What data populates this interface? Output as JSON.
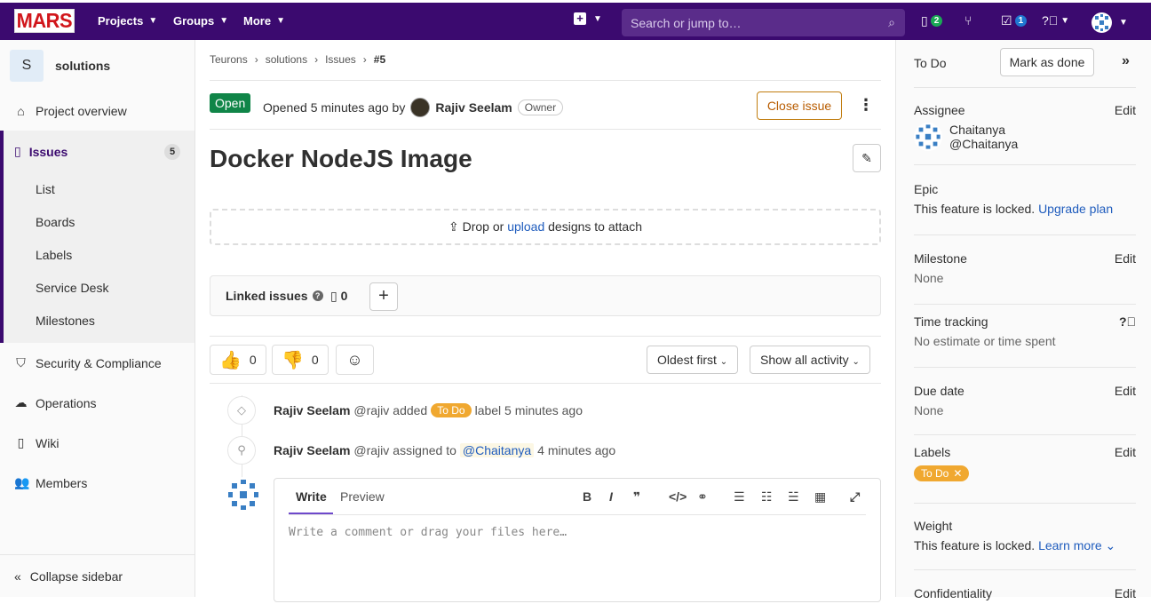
{
  "nav": {
    "logo": "MARS",
    "projects": "Projects",
    "groups": "Groups",
    "more": "More",
    "search_placeholder": "Search or jump to…",
    "mr_count": "2",
    "todo_count": "1"
  },
  "sidebar": {
    "project_initial": "S",
    "project_name": "solutions",
    "project_overview": "Project overview",
    "issues": "Issues",
    "issues_count": "5",
    "sub": [
      "List",
      "Boards",
      "Labels",
      "Service Desk",
      "Milestones"
    ],
    "security": "Security & Compliance",
    "operations": "Operations",
    "wiki": "Wiki",
    "members": "Members",
    "collapse": "Collapse sidebar"
  },
  "breadcrumb": [
    "Teurons",
    "solutions",
    "Issues",
    "#5"
  ],
  "issue": {
    "status": "Open",
    "opened_text": "Opened 5 minutes ago by",
    "author": "Rajiv Seelam",
    "author_role": "Owner",
    "close_label": "Close issue",
    "title": "Docker NodeJS Image",
    "drop_prefix": "Drop or",
    "drop_link": "upload",
    "drop_suffix": "designs to attach",
    "linked_label": "Linked issues",
    "linked_count": "0",
    "thumbs_up": "0",
    "thumbs_down": "0",
    "sort": "Oldest first",
    "filter": "Show all activity"
  },
  "notes": [
    {
      "author": "Rajiv Seelam",
      "handle": "@rajiv",
      "action": "added",
      "label": "To Do",
      "suffix": "label 5 minutes ago"
    },
    {
      "author": "Rajiv Seelam",
      "handle": "@rajiv",
      "action": "assigned to",
      "mention": "@Chaitanya",
      "suffix": "4 minutes ago"
    }
  ],
  "editor": {
    "write": "Write",
    "preview": "Preview",
    "placeholder": "Write a comment or drag your files here…"
  },
  "rightbar": {
    "todo": "To Do",
    "mark_done": "Mark as done",
    "edit": "Edit",
    "assignee_title": "Assignee",
    "assignee_name": "Chaitanya",
    "assignee_handle": "@Chaitanya",
    "epic_title": "Epic",
    "epic_locked": "This feature is locked.",
    "epic_link": "Upgrade plan",
    "milestone_title": "Milestone",
    "milestone_val": "None",
    "time_title": "Time tracking",
    "time_val": "No estimate or time spent",
    "due_title": "Due date",
    "due_val": "None",
    "labels_title": "Labels",
    "label_todo": "To Do",
    "weight_title": "Weight",
    "weight_locked": "This feature is locked.",
    "weight_link": "Learn more",
    "confidentiality_title": "Confidentiality"
  },
  "colors": {
    "navbar": "#3b0a6f",
    "open": "#108548",
    "todo_label": "#f0a830",
    "link": "#1f5cbd"
  }
}
